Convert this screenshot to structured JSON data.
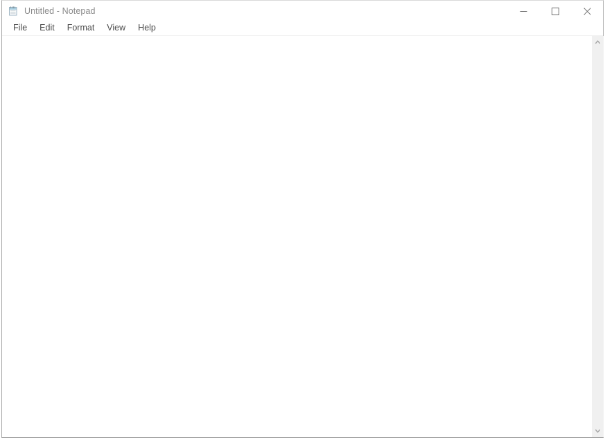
{
  "window": {
    "title": "Untitled - Notepad",
    "icon": "notepad-icon",
    "app": "Notepad"
  },
  "caption_buttons": [
    {
      "name": "minimize",
      "label": "Minimize",
      "glyph": "minimize-icon"
    },
    {
      "name": "maximize",
      "label": "Maximize",
      "glyph": "maximize-icon"
    },
    {
      "name": "close",
      "label": "Close",
      "glyph": "close-icon"
    }
  ],
  "menu": {
    "items": [
      {
        "label": "File"
      },
      {
        "label": "Edit"
      },
      {
        "label": "Format"
      },
      {
        "label": "View"
      },
      {
        "label": "Help"
      }
    ]
  },
  "editor": {
    "content": "",
    "placeholder": ""
  },
  "scrollbar": {
    "up_arrow": "chevron-up-icon",
    "down_arrow": "chevron-down-icon"
  },
  "colors": {
    "title_text": "#8a8a8a",
    "menu_text": "#4a4a4a",
    "window_border": "#a6a6a6",
    "scrollbar_track": "#f0f0f0",
    "scrollbar_arrow": "#a0a0a0",
    "background": "#ffffff"
  }
}
